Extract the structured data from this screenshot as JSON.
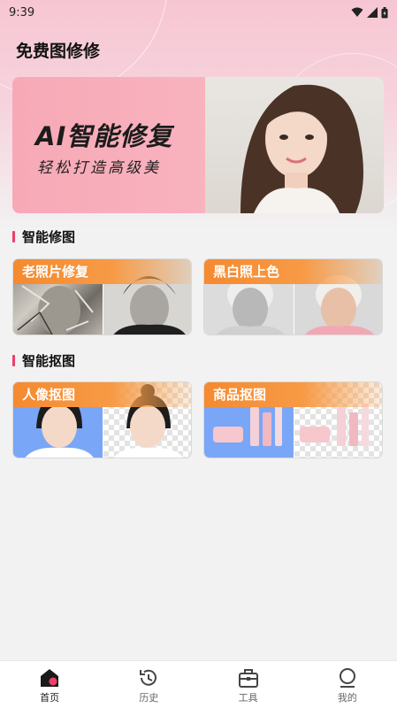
{
  "status_bar": {
    "time": "9:39"
  },
  "app": {
    "title": "免费图修修"
  },
  "banner": {
    "title": "AI智能修复",
    "subtitle": "轻松打造高级美"
  },
  "sections": [
    {
      "title": "智能修图",
      "cards": [
        {
          "label": "老照片修复"
        },
        {
          "label": "黑白照上色"
        }
      ]
    },
    {
      "title": "智能抠图",
      "cards": [
        {
          "label": "人像抠图"
        },
        {
          "label": "商品抠图"
        }
      ]
    }
  ],
  "tabbar": {
    "items": [
      {
        "label": "首页",
        "icon": "home-icon",
        "active": true
      },
      {
        "label": "历史",
        "icon": "history-icon",
        "active": false
      },
      {
        "label": "工具",
        "icon": "toolbox-icon",
        "active": false
      },
      {
        "label": "我的",
        "icon": "profile-icon",
        "active": false
      }
    ]
  },
  "colors": {
    "accent": "#ee3f6b",
    "card_label": "#f58a30",
    "banner_bg": "#f7a9b6",
    "portrait_bg": "#7aa6f7"
  }
}
